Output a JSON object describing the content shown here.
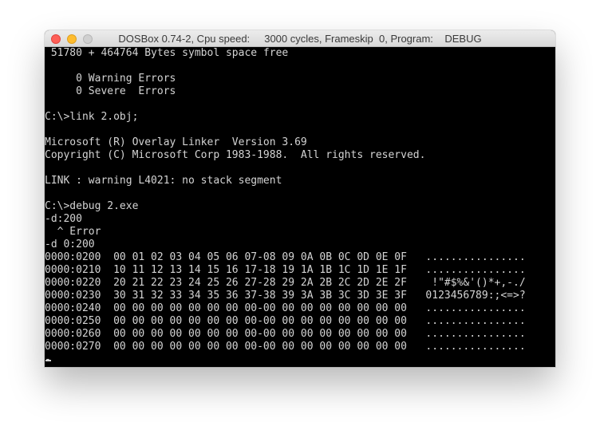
{
  "window": {
    "title": "DOSBox 0.74-2, Cpu speed:     3000 cycles, Frameskip  0, Program:    DEBUG"
  },
  "terminal": {
    "lines": [
      " 51780 + 464764 Bytes symbol space free",
      "",
      "     0 Warning Errors",
      "     0 Severe  Errors",
      "",
      "C:\\>link 2.obj;",
      "",
      "Microsoft (R) Overlay Linker  Version 3.69",
      "Copyright (C) Microsoft Corp 1983-1988.  All rights reserved.",
      "",
      "LINK : warning L4021: no stack segment",
      "",
      "C:\\>debug 2.exe",
      "-d:200",
      "  ^ Error",
      "-d 0:200",
      "0000:0200  00 01 02 03 04 05 06 07-08 09 0A 0B 0C 0D 0E 0F   ................",
      "0000:0210  10 11 12 13 14 15 16 17-18 19 1A 1B 1C 1D 1E 1F   ................",
      "0000:0220  20 21 22 23 24 25 26 27-28 29 2A 2B 2C 2D 2E 2F    !\"#$%&'()*+,-./",
      "0000:0230  30 31 32 33 34 35 36 37-38 39 3A 3B 3C 3D 3E 3F   0123456789:;<=>?",
      "0000:0240  00 00 00 00 00 00 00 00-00 00 00 00 00 00 00 00   ................",
      "0000:0250  00 00 00 00 00 00 00 00-00 00 00 00 00 00 00 00   ................",
      "0000:0260  00 00 00 00 00 00 00 00-00 00 00 00 00 00 00 00   ................",
      "0000:0270  00 00 00 00 00 00 00 00-00 00 00 00 00 00 00 00   ................",
      "-"
    ]
  },
  "colors": {
    "screen_background": "#000000",
    "text": "#d4d4d4",
    "close_button": "#fe5f57",
    "minimize_button": "#febc2e",
    "zoom_button": "#d0d0d0"
  }
}
